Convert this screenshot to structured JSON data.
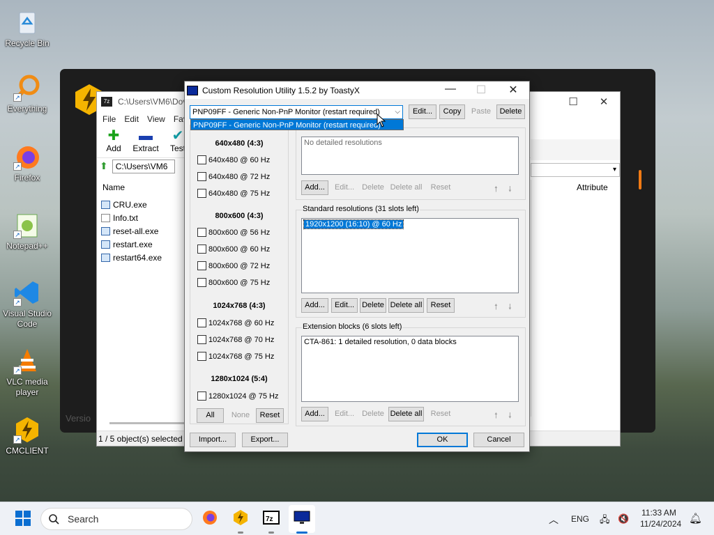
{
  "desktop": {
    "icons": [
      {
        "label": "Recycle Bin",
        "icon": "recycle-bin-icon"
      },
      {
        "label": "Everything",
        "icon": "everything-search-icon"
      },
      {
        "label": "Firefox",
        "icon": "firefox-icon"
      },
      {
        "label": "Notepad++",
        "icon": "notepad-plus-plus-icon"
      },
      {
        "label": "Visual Studio Code",
        "icon": "vscode-icon"
      },
      {
        "label": "VLC media player",
        "icon": "vlc-icon"
      },
      {
        "label": "CMCLIENT",
        "icon": "cmclient-icon"
      }
    ]
  },
  "background_app": {
    "version_text": "Versio"
  },
  "sevenzip": {
    "title_path": "C:\\Users\\VM6\\Dov",
    "menu": [
      "File",
      "Edit",
      "View",
      "Fav"
    ],
    "tools": [
      {
        "label": "Add"
      },
      {
        "label": "Extract"
      },
      {
        "label": "Test"
      }
    ],
    "address": "C:\\Users\\VM6",
    "column_name": "Name",
    "column_attributes": "Attribute",
    "files": [
      {
        "name": "CRU.exe",
        "type": "exe"
      },
      {
        "name": "Info.txt",
        "type": "txt"
      },
      {
        "name": "reset-all.exe",
        "type": "exe"
      },
      {
        "name": "restart.exe",
        "type": "exe"
      },
      {
        "name": "restart64.exe",
        "type": "exe"
      }
    ],
    "status": "1 / 5 object(s) selected"
  },
  "cru": {
    "title": "Custom Resolution Utility 1.5.2 by ToastyX",
    "monitor_selected": "PNP09FF - Generic Non-PnP Monitor (restart required)",
    "dropdown_option": "PNP09FF - Generic Non-PnP Monitor (restart required)",
    "top_buttons": {
      "edit": "Edit...",
      "copy": "Copy",
      "paste": "Paste",
      "delete": "Delete"
    },
    "established": {
      "groups": [
        {
          "title": "640x480 (4:3)",
          "items": [
            "640x480 @ 60 Hz",
            "640x480 @ 72 Hz",
            "640x480 @ 75 Hz"
          ]
        },
        {
          "title": "800x600 (4:3)",
          "items": [
            "800x600 @ 56 Hz",
            "800x600 @ 60 Hz",
            "800x600 @ 72 Hz",
            "800x600 @ 75 Hz"
          ]
        },
        {
          "title": "1024x768 (4:3)",
          "items": [
            "1024x768 @ 60 Hz",
            "1024x768 @ 70 Hz",
            "1024x768 @ 75 Hz"
          ]
        },
        {
          "title": "1280x1024 (5:4)",
          "items": [
            "1280x1024 @ 75 Hz"
          ]
        }
      ],
      "buttons": {
        "all": "All",
        "none": "None",
        "reset": "Reset"
      }
    },
    "detailed": {
      "placeholder": "No detailed resolutions",
      "buttons": {
        "add": "Add...",
        "edit": "Edit...",
        "delete": "Delete",
        "delete_all": "Delete all",
        "reset": "Reset"
      }
    },
    "standard": {
      "label": "Standard resolutions (31 slots left)",
      "items": [
        "1920x1200 (16:10) @ 60 Hz"
      ],
      "buttons": {
        "add": "Add...",
        "edit": "Edit...",
        "delete": "Delete",
        "delete_all": "Delete all",
        "reset": "Reset"
      }
    },
    "extension": {
      "label": "Extension blocks (6 slots left)",
      "items": [
        "CTA-861: 1 detailed resolution, 0 data blocks"
      ],
      "buttons": {
        "add": "Add...",
        "edit": "Edit...",
        "delete": "Delete",
        "delete_all": "Delete all",
        "reset": "Reset"
      }
    },
    "bottom": {
      "import": "Import...",
      "export": "Export...",
      "ok": "OK",
      "cancel": "Cancel"
    }
  },
  "taskbar": {
    "search_placeholder": "Search",
    "language": "ENG",
    "time": "11:33 AM",
    "date": "11/24/2024"
  }
}
